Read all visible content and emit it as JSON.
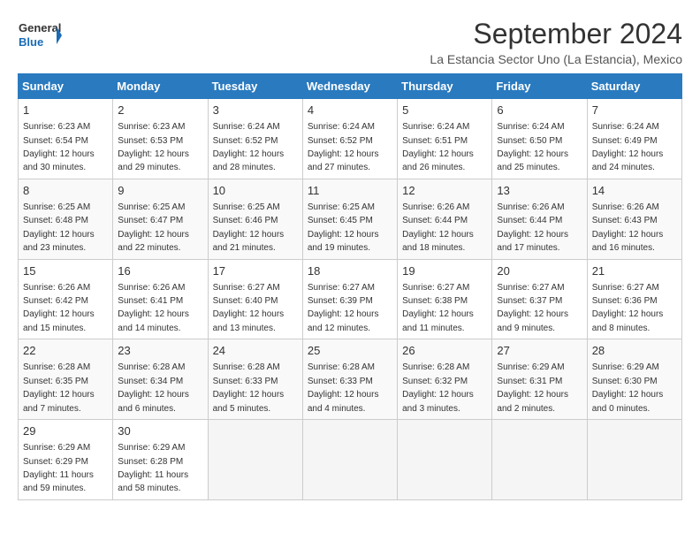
{
  "logo": {
    "line1": "General",
    "line2": "Blue"
  },
  "title": "September 2024",
  "subtitle": "La Estancia Sector Uno (La Estancia), Mexico",
  "weekdays": [
    "Sunday",
    "Monday",
    "Tuesday",
    "Wednesday",
    "Thursday",
    "Friday",
    "Saturday"
  ],
  "weeks": [
    [
      {
        "day": "1",
        "sunrise": "6:23 AM",
        "sunset": "6:54 PM",
        "daylight": "12 hours and 30 minutes."
      },
      {
        "day": "2",
        "sunrise": "6:23 AM",
        "sunset": "6:53 PM",
        "daylight": "12 hours and 29 minutes."
      },
      {
        "day": "3",
        "sunrise": "6:24 AM",
        "sunset": "6:52 PM",
        "daylight": "12 hours and 28 minutes."
      },
      {
        "day": "4",
        "sunrise": "6:24 AM",
        "sunset": "6:52 PM",
        "daylight": "12 hours and 27 minutes."
      },
      {
        "day": "5",
        "sunrise": "6:24 AM",
        "sunset": "6:51 PM",
        "daylight": "12 hours and 26 minutes."
      },
      {
        "day": "6",
        "sunrise": "6:24 AM",
        "sunset": "6:50 PM",
        "daylight": "12 hours and 25 minutes."
      },
      {
        "day": "7",
        "sunrise": "6:24 AM",
        "sunset": "6:49 PM",
        "daylight": "12 hours and 24 minutes."
      }
    ],
    [
      {
        "day": "8",
        "sunrise": "6:25 AM",
        "sunset": "6:48 PM",
        "daylight": "12 hours and 23 minutes."
      },
      {
        "day": "9",
        "sunrise": "6:25 AM",
        "sunset": "6:47 PM",
        "daylight": "12 hours and 22 minutes."
      },
      {
        "day": "10",
        "sunrise": "6:25 AM",
        "sunset": "6:46 PM",
        "daylight": "12 hours and 21 minutes."
      },
      {
        "day": "11",
        "sunrise": "6:25 AM",
        "sunset": "6:45 PM",
        "daylight": "12 hours and 19 minutes."
      },
      {
        "day": "12",
        "sunrise": "6:26 AM",
        "sunset": "6:44 PM",
        "daylight": "12 hours and 18 minutes."
      },
      {
        "day": "13",
        "sunrise": "6:26 AM",
        "sunset": "6:44 PM",
        "daylight": "12 hours and 17 minutes."
      },
      {
        "day": "14",
        "sunrise": "6:26 AM",
        "sunset": "6:43 PM",
        "daylight": "12 hours and 16 minutes."
      }
    ],
    [
      {
        "day": "15",
        "sunrise": "6:26 AM",
        "sunset": "6:42 PM",
        "daylight": "12 hours and 15 minutes."
      },
      {
        "day": "16",
        "sunrise": "6:26 AM",
        "sunset": "6:41 PM",
        "daylight": "12 hours and 14 minutes."
      },
      {
        "day": "17",
        "sunrise": "6:27 AM",
        "sunset": "6:40 PM",
        "daylight": "12 hours and 13 minutes."
      },
      {
        "day": "18",
        "sunrise": "6:27 AM",
        "sunset": "6:39 PM",
        "daylight": "12 hours and 12 minutes."
      },
      {
        "day": "19",
        "sunrise": "6:27 AM",
        "sunset": "6:38 PM",
        "daylight": "12 hours and 11 minutes."
      },
      {
        "day": "20",
        "sunrise": "6:27 AM",
        "sunset": "6:37 PM",
        "daylight": "12 hours and 9 minutes."
      },
      {
        "day": "21",
        "sunrise": "6:27 AM",
        "sunset": "6:36 PM",
        "daylight": "12 hours and 8 minutes."
      }
    ],
    [
      {
        "day": "22",
        "sunrise": "6:28 AM",
        "sunset": "6:35 PM",
        "daylight": "12 hours and 7 minutes."
      },
      {
        "day": "23",
        "sunrise": "6:28 AM",
        "sunset": "6:34 PM",
        "daylight": "12 hours and 6 minutes."
      },
      {
        "day": "24",
        "sunrise": "6:28 AM",
        "sunset": "6:33 PM",
        "daylight": "12 hours and 5 minutes."
      },
      {
        "day": "25",
        "sunrise": "6:28 AM",
        "sunset": "6:33 PM",
        "daylight": "12 hours and 4 minutes."
      },
      {
        "day": "26",
        "sunrise": "6:28 AM",
        "sunset": "6:32 PM",
        "daylight": "12 hours and 3 minutes."
      },
      {
        "day": "27",
        "sunrise": "6:29 AM",
        "sunset": "6:31 PM",
        "daylight": "12 hours and 2 minutes."
      },
      {
        "day": "28",
        "sunrise": "6:29 AM",
        "sunset": "6:30 PM",
        "daylight": "12 hours and 0 minutes."
      }
    ],
    [
      {
        "day": "29",
        "sunrise": "6:29 AM",
        "sunset": "6:29 PM",
        "daylight": "11 hours and 59 minutes."
      },
      {
        "day": "30",
        "sunrise": "6:29 AM",
        "sunset": "6:28 PM",
        "daylight": "11 hours and 58 minutes."
      },
      null,
      null,
      null,
      null,
      null
    ]
  ],
  "labels": {
    "sunrise": "Sunrise:",
    "sunset": "Sunset:",
    "daylight": "Daylight:"
  }
}
